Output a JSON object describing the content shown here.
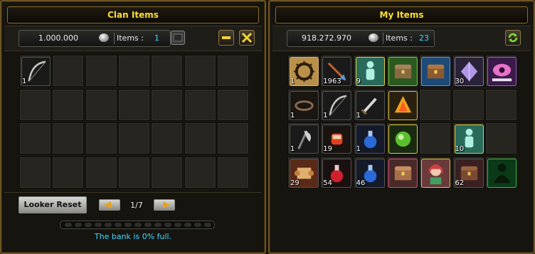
{
  "clan": {
    "title": "Clan Items",
    "money": "1.000.000",
    "items_label": "Items :",
    "items_count": "1",
    "reset_label": "Looker Reset",
    "page": "1/7",
    "capacity_text": "The bank is 0% full.",
    "capacity_fraction": 0,
    "slots": [
      {
        "icon": "bow-icon",
        "qty": "1"
      }
    ]
  },
  "mine": {
    "title": "My Items",
    "money": "918.272.970",
    "items_label": "Items :",
    "items_count": "23",
    "slots": [
      {
        "icon": "thorn-crown-icon",
        "qty": "1"
      },
      {
        "icon": "arrow-icon",
        "qty": "1963"
      },
      {
        "icon": "green-figure-icon",
        "qty": "9"
      },
      {
        "icon": "green-chest-icon",
        "qty": ""
      },
      {
        "icon": "blue-chest-icon",
        "qty": ""
      },
      {
        "icon": "purple-gem-icon",
        "qty": "30"
      },
      {
        "icon": "pink-eye-icon",
        "qty": ""
      },
      {
        "icon": "bracelet-icon",
        "qty": "1"
      },
      {
        "icon": "bow-icon",
        "qty": "1"
      },
      {
        "icon": "dagger-icon",
        "qty": "1"
      },
      {
        "icon": "fire-gem-icon",
        "qty": ""
      },
      {
        "icon": "empty",
        "qty": ""
      },
      {
        "icon": "empty",
        "qty": ""
      },
      {
        "icon": "empty",
        "qty": ""
      },
      {
        "icon": "axe-icon",
        "qty": "1"
      },
      {
        "icon": "fist-icon",
        "qty": "19"
      },
      {
        "icon": "blue-potion-icon",
        "qty": "1"
      },
      {
        "icon": "green-orb-icon",
        "qty": ""
      },
      {
        "icon": "empty",
        "qty": ""
      },
      {
        "icon": "green-figure-icon",
        "qty": "10"
      },
      {
        "icon": "empty",
        "qty": ""
      },
      {
        "icon": "scroll-icon",
        "qty": "29"
      },
      {
        "icon": "red-potion-icon",
        "qty": "54"
      },
      {
        "icon": "blue-potion-icon",
        "qty": "46"
      },
      {
        "icon": "pink-chest-icon",
        "qty": ""
      },
      {
        "icon": "girl-portrait-icon",
        "qty": ""
      },
      {
        "icon": "red-chest-icon",
        "qty": "62"
      },
      {
        "icon": "green-shadow-icon",
        "qty": ""
      }
    ]
  },
  "colors": {
    "gold": "#ffde32",
    "cyan": "#44d8ff",
    "frame": "#6e5423"
  }
}
